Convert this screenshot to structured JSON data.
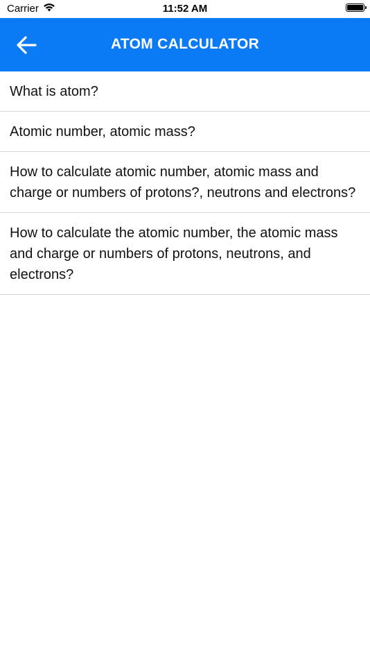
{
  "status_bar": {
    "carrier": "Carrier",
    "time": "11:52 AM",
    "wifi_icon": "wifi-icon",
    "battery_icon": "battery-icon"
  },
  "nav": {
    "title": "ATOM CALCULATOR",
    "back_icon": "arrow-left-icon",
    "background_color": "#0a7bf5"
  },
  "list": {
    "items": [
      {
        "label": "What is atom?"
      },
      {
        "label": "Atomic number, atomic mass?"
      },
      {
        "label": "How to calculate atomic number, atomic mass and charge or numbers of protons?, neutrons and electrons?"
      },
      {
        "label": "How to calculate the atomic number, the atomic mass and charge or numbers of protons, neutrons, and electrons?"
      }
    ]
  }
}
